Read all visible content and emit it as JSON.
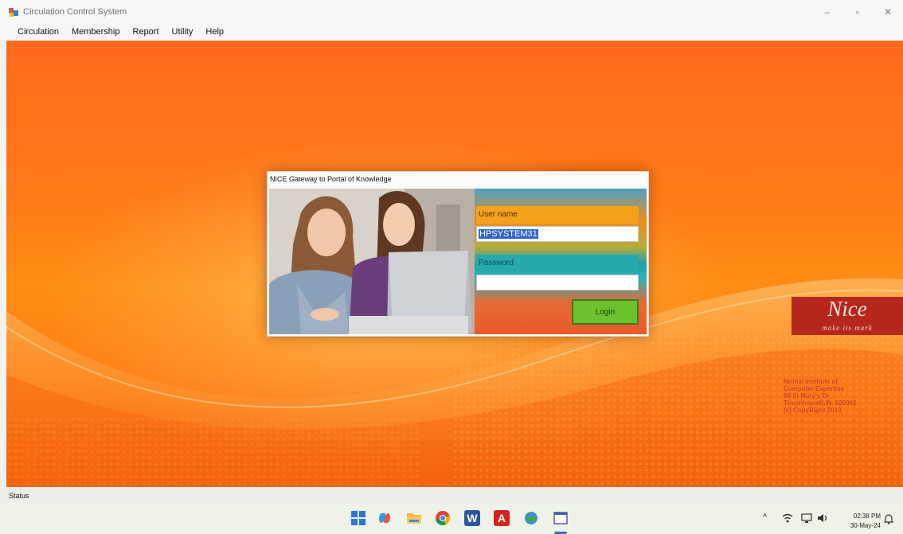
{
  "window": {
    "title": "Circulation Control System",
    "controls": {
      "minimize": "–",
      "maximize": "▫",
      "close": "✕"
    }
  },
  "menu": [
    "Circulation",
    "Membership",
    "Report",
    "Utility",
    "Help"
  ],
  "login_dialog": {
    "title": "NICE Gateway to Portal of Knowledge",
    "username_label": "User name",
    "username_value": "HPSYSTEM31",
    "password_label": "Password",
    "password_value": "",
    "login_button": "Login"
  },
  "branding": {
    "logo_word": "Nice",
    "logo_tagline": "make its mark",
    "institute_lines": [
      "Nirmal Institute of",
      "Computer Expertise",
      "98 St Mary's Dr",
      "Tiruchirapalli,IN. 620002",
      "(c) CopyRight 2013"
    ]
  },
  "status_bar": {
    "label": "Status"
  },
  "taskbar": {
    "clock_time": "02:38 PM",
    "clock_date": "30-May-24",
    "icons": [
      "windows-start-icon",
      "copilot-icon",
      "file-explorer-icon",
      "chrome-icon",
      "word-icon",
      "acrobat-icon",
      "globe-app-icon",
      "app-window-icon"
    ],
    "tray_icons": [
      "chevron-up-icon",
      "wifi-icon",
      "network-icon",
      "volume-icon",
      "notification-bell-icon"
    ]
  },
  "colors": {
    "orange_bg": "#ff7a16",
    "login_button": "#6cc12d",
    "selection": "#2f64c9",
    "logo_bg": "#b5261d"
  }
}
